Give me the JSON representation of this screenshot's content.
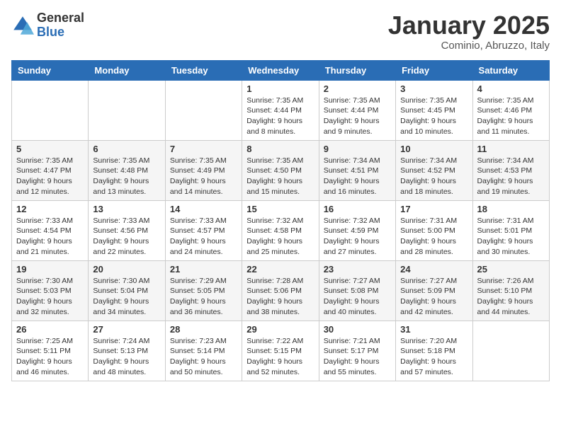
{
  "logo": {
    "general": "General",
    "blue": "Blue"
  },
  "header": {
    "month": "January 2025",
    "location": "Cominio, Abruzzo, Italy"
  },
  "weekdays": [
    "Sunday",
    "Monday",
    "Tuesday",
    "Wednesday",
    "Thursday",
    "Friday",
    "Saturday"
  ],
  "weeks": [
    [
      {
        "day": "",
        "info": ""
      },
      {
        "day": "",
        "info": ""
      },
      {
        "day": "",
        "info": ""
      },
      {
        "day": "1",
        "info": "Sunrise: 7:35 AM\nSunset: 4:44 PM\nDaylight: 9 hours\nand 8 minutes."
      },
      {
        "day": "2",
        "info": "Sunrise: 7:35 AM\nSunset: 4:44 PM\nDaylight: 9 hours\nand 9 minutes."
      },
      {
        "day": "3",
        "info": "Sunrise: 7:35 AM\nSunset: 4:45 PM\nDaylight: 9 hours\nand 10 minutes."
      },
      {
        "day": "4",
        "info": "Sunrise: 7:35 AM\nSunset: 4:46 PM\nDaylight: 9 hours\nand 11 minutes."
      }
    ],
    [
      {
        "day": "5",
        "info": "Sunrise: 7:35 AM\nSunset: 4:47 PM\nDaylight: 9 hours\nand 12 minutes."
      },
      {
        "day": "6",
        "info": "Sunrise: 7:35 AM\nSunset: 4:48 PM\nDaylight: 9 hours\nand 13 minutes."
      },
      {
        "day": "7",
        "info": "Sunrise: 7:35 AM\nSunset: 4:49 PM\nDaylight: 9 hours\nand 14 minutes."
      },
      {
        "day": "8",
        "info": "Sunrise: 7:35 AM\nSunset: 4:50 PM\nDaylight: 9 hours\nand 15 minutes."
      },
      {
        "day": "9",
        "info": "Sunrise: 7:34 AM\nSunset: 4:51 PM\nDaylight: 9 hours\nand 16 minutes."
      },
      {
        "day": "10",
        "info": "Sunrise: 7:34 AM\nSunset: 4:52 PM\nDaylight: 9 hours\nand 18 minutes."
      },
      {
        "day": "11",
        "info": "Sunrise: 7:34 AM\nSunset: 4:53 PM\nDaylight: 9 hours\nand 19 minutes."
      }
    ],
    [
      {
        "day": "12",
        "info": "Sunrise: 7:33 AM\nSunset: 4:54 PM\nDaylight: 9 hours\nand 21 minutes."
      },
      {
        "day": "13",
        "info": "Sunrise: 7:33 AM\nSunset: 4:56 PM\nDaylight: 9 hours\nand 22 minutes."
      },
      {
        "day": "14",
        "info": "Sunrise: 7:33 AM\nSunset: 4:57 PM\nDaylight: 9 hours\nand 24 minutes."
      },
      {
        "day": "15",
        "info": "Sunrise: 7:32 AM\nSunset: 4:58 PM\nDaylight: 9 hours\nand 25 minutes."
      },
      {
        "day": "16",
        "info": "Sunrise: 7:32 AM\nSunset: 4:59 PM\nDaylight: 9 hours\nand 27 minutes."
      },
      {
        "day": "17",
        "info": "Sunrise: 7:31 AM\nSunset: 5:00 PM\nDaylight: 9 hours\nand 28 minutes."
      },
      {
        "day": "18",
        "info": "Sunrise: 7:31 AM\nSunset: 5:01 PM\nDaylight: 9 hours\nand 30 minutes."
      }
    ],
    [
      {
        "day": "19",
        "info": "Sunrise: 7:30 AM\nSunset: 5:03 PM\nDaylight: 9 hours\nand 32 minutes."
      },
      {
        "day": "20",
        "info": "Sunrise: 7:30 AM\nSunset: 5:04 PM\nDaylight: 9 hours\nand 34 minutes."
      },
      {
        "day": "21",
        "info": "Sunrise: 7:29 AM\nSunset: 5:05 PM\nDaylight: 9 hours\nand 36 minutes."
      },
      {
        "day": "22",
        "info": "Sunrise: 7:28 AM\nSunset: 5:06 PM\nDaylight: 9 hours\nand 38 minutes."
      },
      {
        "day": "23",
        "info": "Sunrise: 7:27 AM\nSunset: 5:08 PM\nDaylight: 9 hours\nand 40 minutes."
      },
      {
        "day": "24",
        "info": "Sunrise: 7:27 AM\nSunset: 5:09 PM\nDaylight: 9 hours\nand 42 minutes."
      },
      {
        "day": "25",
        "info": "Sunrise: 7:26 AM\nSunset: 5:10 PM\nDaylight: 9 hours\nand 44 minutes."
      }
    ],
    [
      {
        "day": "26",
        "info": "Sunrise: 7:25 AM\nSunset: 5:11 PM\nDaylight: 9 hours\nand 46 minutes."
      },
      {
        "day": "27",
        "info": "Sunrise: 7:24 AM\nSunset: 5:13 PM\nDaylight: 9 hours\nand 48 minutes."
      },
      {
        "day": "28",
        "info": "Sunrise: 7:23 AM\nSunset: 5:14 PM\nDaylight: 9 hours\nand 50 minutes."
      },
      {
        "day": "29",
        "info": "Sunrise: 7:22 AM\nSunset: 5:15 PM\nDaylight: 9 hours\nand 52 minutes."
      },
      {
        "day": "30",
        "info": "Sunrise: 7:21 AM\nSunset: 5:17 PM\nDaylight: 9 hours\nand 55 minutes."
      },
      {
        "day": "31",
        "info": "Sunrise: 7:20 AM\nSunset: 5:18 PM\nDaylight: 9 hours\nand 57 minutes."
      },
      {
        "day": "",
        "info": ""
      }
    ]
  ]
}
